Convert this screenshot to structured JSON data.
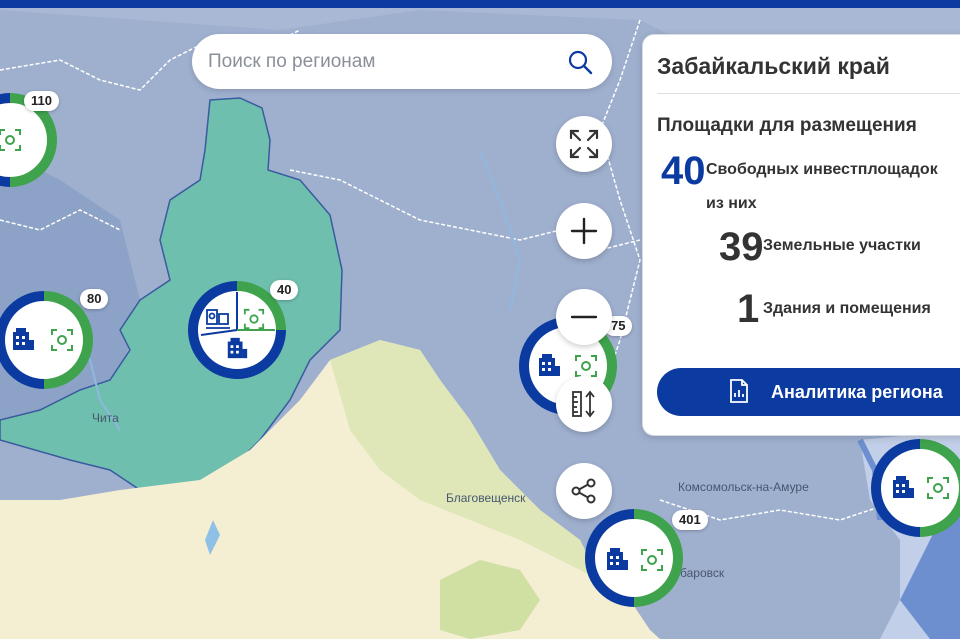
{
  "search": {
    "placeholder": "Поиск по регионам"
  },
  "panel": {
    "title": "Забайкальский край",
    "subtitle": "Площадки для размещения",
    "free_count": "40",
    "free_label": "Свободных инвестплощадок",
    "of_them": "из них",
    "land_count": "39",
    "land_label": "Земельные участки",
    "building_count": "1",
    "building_label": "Здания и помещения",
    "analytics_button": "Аналитика региона"
  },
  "markers": [
    {
      "name": "marker-110",
      "count": "110"
    },
    {
      "name": "marker-80",
      "count": "80"
    },
    {
      "name": "marker-40",
      "count": "40"
    },
    {
      "name": "marker-75",
      "count": "75"
    },
    {
      "name": "marker-401",
      "count": "401"
    }
  ],
  "cities": {
    "chita": "Чита",
    "blagoveshchensk": "Благовещенск",
    "komsomolsk": "Комсомольск-на-Амуре",
    "khabarovsk": "баровск"
  },
  "colors": {
    "brand_blue": "#0b3aa0",
    "ring_green": "#3fa34d",
    "selected_region": "#6fbfae",
    "map_base": "#9fb0cf",
    "land_yellow": "#f4eed3"
  },
  "controls": {
    "fullscreen": "expand-icon",
    "zoom_in": "plus-icon",
    "zoom_out": "minus-icon",
    "ruler": "ruler-icon",
    "share": "share-icon"
  }
}
